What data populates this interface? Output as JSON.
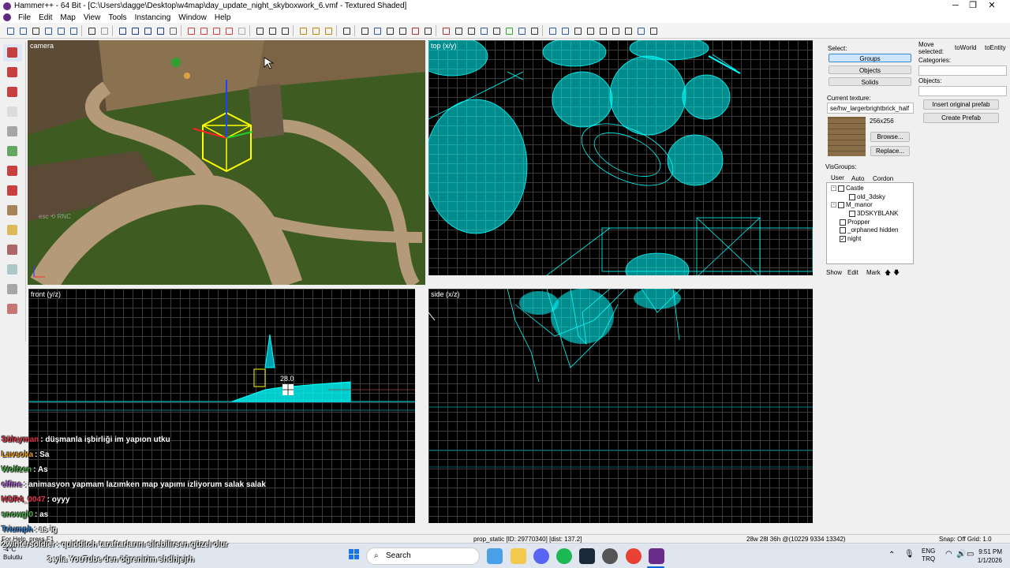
{
  "window": {
    "title": "Hammer++ - 64 Bit - [C:\\Users\\dagge\\Desktop\\w4map\\day_update_night_skyboxwork_6.vmf - Textured Shaded]",
    "controls": [
      "─",
      "❐",
      "✕"
    ]
  },
  "menu": [
    "File",
    "Edit",
    "Map",
    "View",
    "Tools",
    "Instancing",
    "Window",
    "Help"
  ],
  "viewports": {
    "camera": "camera",
    "top": "top (x/y)",
    "front": "front (y/z)",
    "side": "side (x/z)",
    "front_size_readout": "28.0"
  },
  "select_panel": {
    "label": "Select:",
    "buttons": [
      "Groups",
      "Objects",
      "Solids"
    ],
    "active": "Groups"
  },
  "texture_panel": {
    "label": "Current texture:",
    "value": "se/hw_largerbrightbrick_half",
    "size": "256x256",
    "browse": "Browse...",
    "replace": "Replace..."
  },
  "visgroups": {
    "label": "VisGroups:",
    "tabs": [
      "User",
      "Auto",
      "Cordon"
    ],
    "items": [
      {
        "name": "Castle",
        "checked": false,
        "level": 0,
        "expander": "-"
      },
      {
        "name": "old_3dsky",
        "checked": false,
        "level": 1
      },
      {
        "name": "M_manor",
        "checked": false,
        "level": 0,
        "expander": "-"
      },
      {
        "name": "3DSKYBLANK",
        "checked": false,
        "level": 1
      },
      {
        "name": "Propper",
        "checked": false,
        "level": 0
      },
      {
        "name": "_orphaned hidden",
        "checked": false,
        "level": 0
      },
      {
        "name": "night",
        "checked": true,
        "level": 0
      }
    ],
    "show": "Show",
    "edit": "Edit",
    "mark": "Mark",
    "up": "🡅",
    "down": "🡇"
  },
  "move_panel": {
    "label": "Move selected:",
    "to_world": "toWorld",
    "to_entity": "toEntity",
    "categories": "Categories:",
    "objects": "Objects:",
    "insert_prefab": "Insert original prefab",
    "create_prefab": "Create Prefab"
  },
  "status": {
    "help": "For Help, press F1",
    "object": "prop_static  [ID: 29770340]  [dist: 137.2]",
    "coords": "28w 28l 36h @(10229 9334 13342)",
    "snap": "Snap: Off Grid: 1.0"
  },
  "chat": [
    {
      "user": "Süleyman",
      "message": ": düşmanla işbirliği im yapıon utku",
      "color": "#e0344a"
    },
    {
      "user": "Lavsoka",
      "message": ": Sa",
      "color": "#e89a1a"
    },
    {
      "user": "Wolfzen",
      "message": ": As",
      "color": "#4fb04f"
    },
    {
      "user": "elfine",
      "message": ": animasyon yapmam lazımken map yapımı izliyorum salak salak",
      "color": "#b86fe0"
    },
    {
      "user": "NOR4_0047",
      "message": ": oyyy",
      "color": "#e0344a"
    },
    {
      "user": "snowgl0",
      "message": ": as",
      "color": "#4fb04f"
    },
    {
      "user": "Triumph",
      "message": ": as ig",
      "color": "#3a8ad6"
    },
    {
      "user": "2wintersoldier",
      "message": ": quidditch taraftarlarını silebilirsen güzel olur",
      "color": "#ffffff"
    },
    {
      "user": "",
      "message": "3 yıla YouTube den öğrenirim shdhjejrh",
      "color": "#ffffff"
    }
  ],
  "taskbar": {
    "weather_temp": "-4°C",
    "weather_label": "Bulutlu",
    "search": "Search",
    "lang1": "ENG",
    "lang2": "TRQ",
    "time": "9:51 PM",
    "date": "1/1/2026"
  },
  "colors": {
    "wire": "#00ffff",
    "select_yellow": "#ffff00",
    "grass": "#3e5c22",
    "path": "#b49a78",
    "accent": "#3a8ad6"
  }
}
